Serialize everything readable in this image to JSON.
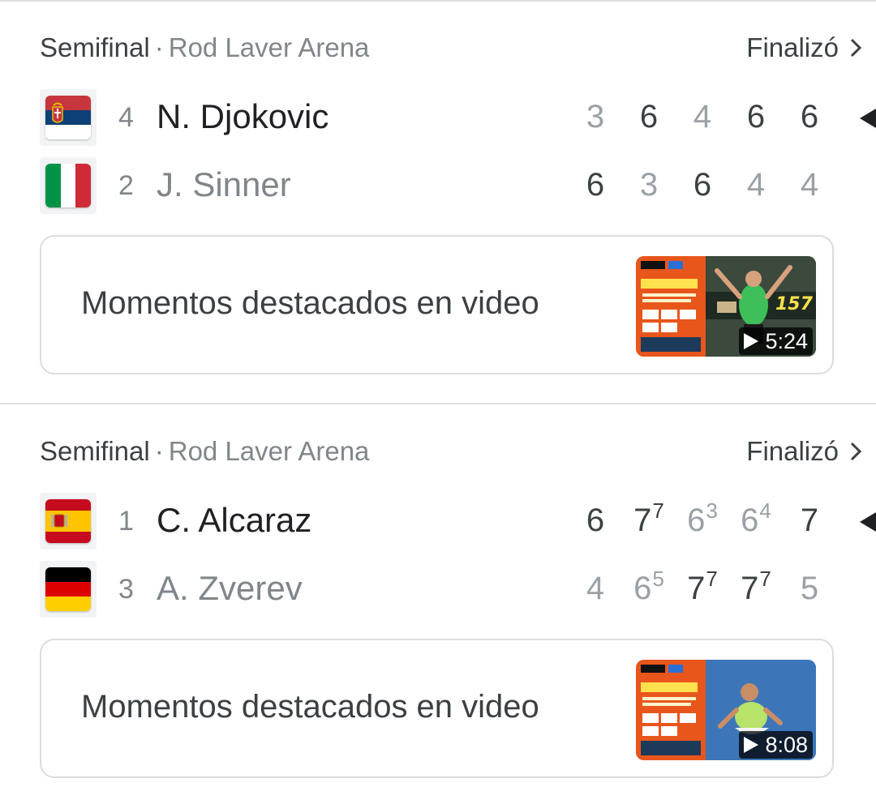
{
  "matches": [
    {
      "stage": "Semifinal",
      "separator": "·",
      "venue": "Rod Laver Arena",
      "status": "Finalizó",
      "players": [
        {
          "seed": "4",
          "name": "N. Djokovic",
          "country": "Serbia",
          "winner": true,
          "sets": [
            {
              "games": "3",
              "tiebreak": "",
              "won": false
            },
            {
              "games": "6",
              "tiebreak": "",
              "won": true
            },
            {
              "games": "4",
              "tiebreak": "",
              "won": false
            },
            {
              "games": "6",
              "tiebreak": "",
              "won": true
            },
            {
              "games": "6",
              "tiebreak": "",
              "won": true
            }
          ]
        },
        {
          "seed": "2",
          "name": "J. Sinner",
          "country": "Italy",
          "winner": false,
          "sets": [
            {
              "games": "6",
              "tiebreak": "",
              "won": true
            },
            {
              "games": "3",
              "tiebreak": "",
              "won": false
            },
            {
              "games": "6",
              "tiebreak": "",
              "won": true
            },
            {
              "games": "4",
              "tiebreak": "",
              "won": false
            },
            {
              "games": "4",
              "tiebreak": "",
              "won": false
            }
          ]
        }
      ],
      "highlights": {
        "label": "Momentos destacados en video",
        "duration": "5:24",
        "thumbnail": {
          "channel": "ESPN",
          "title_line": "LO MEJOR DE",
          "badge": "157",
          "colors": {
            "panel": "#e8561c",
            "bg": "#2f3b30",
            "shirt": "#3fbf5a"
          }
        }
      }
    },
    {
      "stage": "Semifinal",
      "separator": "·",
      "venue": "Rod Laver Arena",
      "status": "Finalizó",
      "players": [
        {
          "seed": "1",
          "name": "C. Alcaraz",
          "country": "Spain",
          "winner": true,
          "sets": [
            {
              "games": "6",
              "tiebreak": "",
              "won": true
            },
            {
              "games": "7",
              "tiebreak": "7",
              "won": true
            },
            {
              "games": "6",
              "tiebreak": "3",
              "won": false
            },
            {
              "games": "6",
              "tiebreak": "4",
              "won": false
            },
            {
              "games": "7",
              "tiebreak": "",
              "won": true
            }
          ]
        },
        {
          "seed": "3",
          "name": "A. Zverev",
          "country": "Germany",
          "winner": false,
          "sets": [
            {
              "games": "4",
              "tiebreak": "",
              "won": false
            },
            {
              "games": "6",
              "tiebreak": "5",
              "won": false
            },
            {
              "games": "7",
              "tiebreak": "7",
              "won": true
            },
            {
              "games": "7",
              "tiebreak": "7",
              "won": true
            },
            {
              "games": "5",
              "tiebreak": "",
              "won": false
            }
          ]
        }
      ],
      "highlights": {
        "label": "Momentos destacados en video",
        "duration": "8:08",
        "thumbnail": {
          "channel": "ESPN",
          "title_line": "LO MEJOR DE",
          "badge": "",
          "colors": {
            "panel": "#e8561c",
            "bg": "#3d76b8",
            "shirt": "#b7e36a"
          }
        }
      }
    }
  ],
  "theme": {
    "winner_text": "#3c4043",
    "loser_text": "#9aa0a6",
    "border": "#dadce0"
  }
}
